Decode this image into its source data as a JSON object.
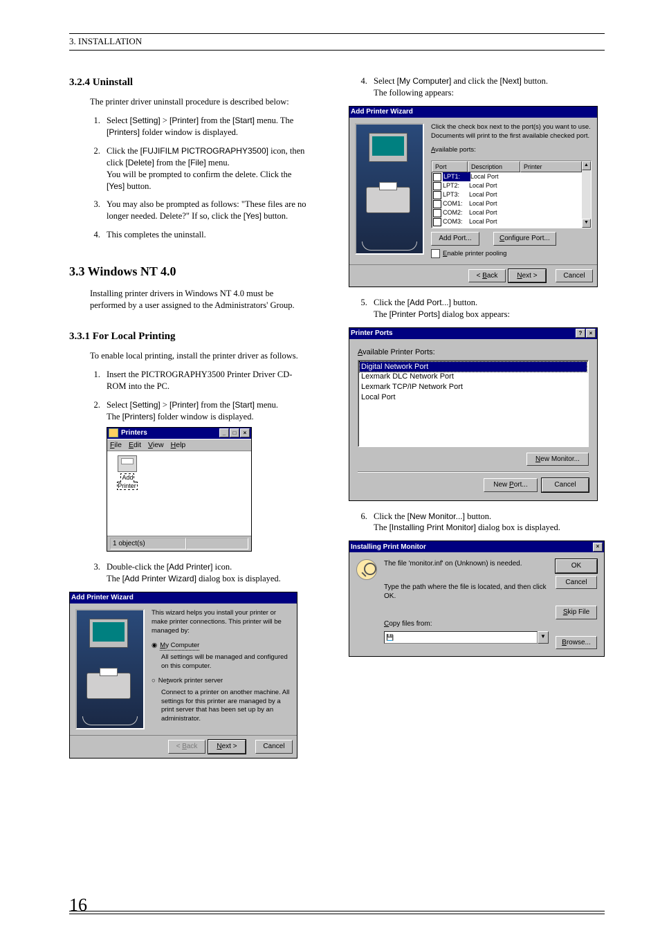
{
  "header": {
    "text": "3. INSTALLATION"
  },
  "left": {
    "h324": "3.2.4   Uninstall",
    "intro324": "The printer driver uninstall procedure is described below:",
    "s324": [
      "Select [Setting] > [Printer] from the [Start] menu. The [Printers] folder window is displayed.",
      "Click the [FUJIFILM PICTROGRAPHY3500] icon, then click [Delete] from the [File] menu.\nYou will be prompted to confirm the delete. Click the [Yes] button.",
      "You may also be prompted as follows: \"These files are no longer needed. Delete?\" If so, click the [Yes] button.",
      "This completes the uninstall."
    ],
    "h33": "3.3  Windows NT 4.0",
    "intro33": "Installing printer drivers in Windows NT 4.0 must be performed by a user assigned to the Administrators' Group.",
    "h331": "3.3.1   For Local Printing",
    "intro331": "To enable local printing, install the printer driver as follows.",
    "s331_1": "Insert the PICTROGRAPHY3500 Printer Driver CD-ROM into the PC.",
    "s331_2a": "Select [Setting] > [Printer] from the [Start] menu.",
    "s331_2b": "The [Printers] folder window is displayed.",
    "s331_3a": "Double-click the [Add Printer] icon.",
    "s331_3b": "The [Add Printer Wizard] dialog box is displayed."
  },
  "printersWin": {
    "title": "Printers",
    "menu": [
      "File",
      "Edit",
      "View",
      "Help"
    ],
    "icon": "Add Printer",
    "status": "1 object(s)"
  },
  "wizard1": {
    "title": "Add Printer Wizard",
    "text": "This wizard helps you install your printer or make printer connections.  This printer will be managed by:",
    "opt1": "My Computer",
    "opt1desc": "All settings will be managed and configured on this computer.",
    "opt2": "Network printer server",
    "opt2desc": "Connect to a printer on another machine.  All settings for this printer are managed by a print server that has been set up by an administrator.",
    "back": "< Back",
    "next": "Next >",
    "cancel": "Cancel"
  },
  "right": {
    "s4a": "Select [My Computer] and click the [Next] button.",
    "s4b": "The following appears:",
    "s5a": "Click the [Add Port...] button.",
    "s5b": "The [Printer Ports] dialog box appears:",
    "s6a": "Click the [New Monitor...] button.",
    "s6b": "The [Installing Print Monitor] dialog box is displayed."
  },
  "wizard2": {
    "title": "Add Printer Wizard",
    "text": "Click the check box next to the port(s) you want to use. Documents will print to the first available checked port.",
    "avail": "Available ports:",
    "cols": [
      "Port",
      "Description",
      "Printer"
    ],
    "rows": [
      [
        "LPT1:",
        "Local Port",
        ""
      ],
      [
        "LPT2:",
        "Local Port",
        ""
      ],
      [
        "LPT3:",
        "Local Port",
        ""
      ],
      [
        "COM1:",
        "Local Port",
        ""
      ],
      [
        "COM2:",
        "Local Port",
        ""
      ],
      [
        "COM3:",
        "Local Port",
        ""
      ]
    ],
    "addport": "Add Port...",
    "configport": "Configure Port...",
    "pool": "Enable printer pooling",
    "back": "< Back",
    "next": "Next >",
    "cancel": "Cancel"
  },
  "pp": {
    "title": "Printer Ports",
    "avail": "Available Printer Ports:",
    "items": [
      "Digital Network Port",
      "Lexmark DLC Network Port",
      "Lexmark TCP/IP Network Port",
      "Local Port"
    ],
    "newmon": "New Monitor...",
    "newport": "New Port...",
    "cancel": "Cancel"
  },
  "ipm": {
    "title": "Installing Print Monitor",
    "msg": "The file 'monitor.inf' on (Unknown) is needed.",
    "msg2": "Type the path where the file is located, and then click OK.",
    "copy": "Copy files from:",
    "ok": "OK",
    "cancel": "Cancel",
    "skip": "Skip File",
    "browse": "Browse..."
  },
  "pageNum": "16"
}
